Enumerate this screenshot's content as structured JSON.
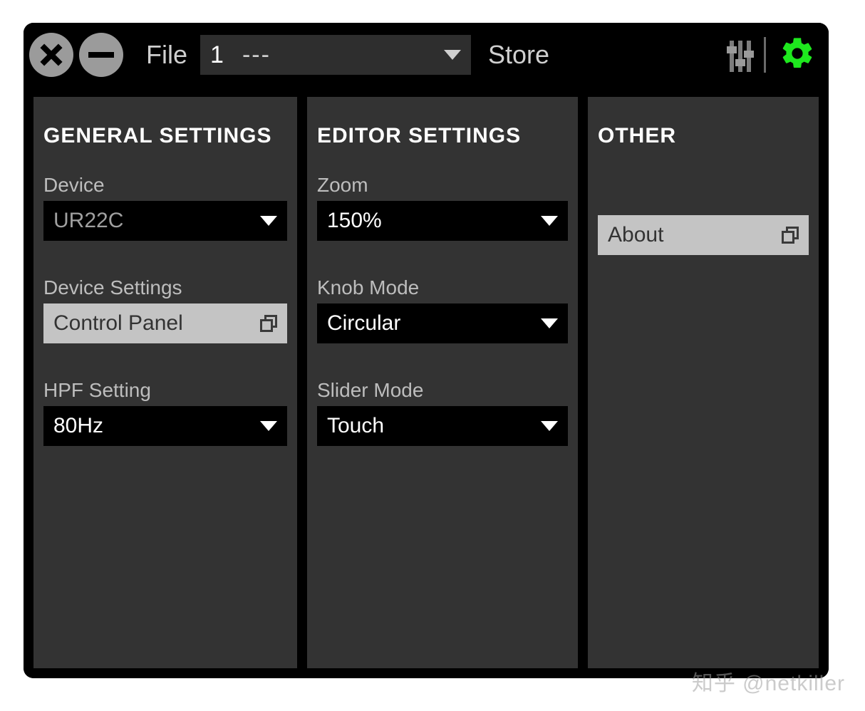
{
  "topbar": {
    "file_label": "File",
    "file_number": "1",
    "file_name": "---",
    "store_label": "Store"
  },
  "panels": {
    "general": {
      "title": "GENERAL SETTINGS",
      "device_label": "Device",
      "device_value": "UR22C",
      "device_settings_label": "Device Settings",
      "device_settings_button": "Control Panel",
      "hpf_label": "HPF Setting",
      "hpf_value": "80Hz"
    },
    "editor": {
      "title": "EDITOR SETTINGS",
      "zoom_label": "Zoom",
      "zoom_value": "150%",
      "knob_mode_label": "Knob Mode",
      "knob_mode_value": "Circular",
      "slider_mode_label": "Slider Mode",
      "slider_mode_value": "Touch"
    },
    "other": {
      "title": "OTHER",
      "about_button": "About"
    }
  },
  "colors": {
    "accent_green": "#1EE81E",
    "panel_bg": "#333333",
    "select_bg": "#000000",
    "light_btn_bg": "#C4C4C4"
  },
  "watermark": "知乎 @netkiller"
}
